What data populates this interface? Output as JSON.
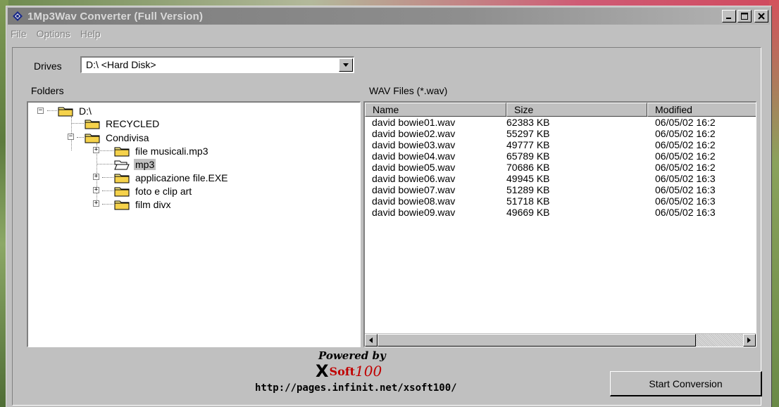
{
  "window": {
    "title": "1Mp3Wav Converter (Full Version)"
  },
  "menu": [
    {
      "label": "File"
    },
    {
      "label": "Options"
    },
    {
      "label": "Help"
    }
  ],
  "drives": {
    "label": "Drives",
    "selected": "D:\\ <Hard Disk>"
  },
  "folders": {
    "label": "Folders",
    "nodes": [
      {
        "label": "D:\\",
        "level": 0,
        "expanded": true
      },
      {
        "label": "RECYCLED",
        "level": 1
      },
      {
        "label": "Condivisa",
        "level": 1,
        "expanded": true
      },
      {
        "label": "file musicali.mp3",
        "level": 2,
        "collapsed": true
      },
      {
        "label": "mp3",
        "level": 2,
        "selected": true,
        "open": true
      },
      {
        "label": "applicazione file.EXE",
        "level": 2,
        "collapsed": true
      },
      {
        "label": "foto e clip art",
        "level": 2,
        "collapsed": true
      },
      {
        "label": "film divx",
        "level": 2,
        "collapsed": true
      }
    ]
  },
  "wav": {
    "label": "WAV Files (*.wav)",
    "columns": [
      "Name",
      "Size",
      "Modified"
    ],
    "rows": [
      [
        "david bowie01.wav",
        "62383 KB",
        "06/05/02 16:2"
      ],
      [
        "david bowie02.wav",
        "55297 KB",
        "06/05/02 16:2"
      ],
      [
        "david bowie03.wav",
        "49777 KB",
        "06/05/02 16:2"
      ],
      [
        "david bowie04.wav",
        "65789 KB",
        "06/05/02 16:2"
      ],
      [
        "david bowie05.wav",
        "70686 KB",
        "06/05/02 16:2"
      ],
      [
        "david bowie06.wav",
        "49945 KB",
        "06/05/02 16:3"
      ],
      [
        "david bowie07.wav",
        "51289 KB",
        "06/05/02 16:3"
      ],
      [
        "david bowie08.wav",
        "51718 KB",
        "06/05/02 16:3"
      ],
      [
        "david bowie09.wav",
        "49669 KB",
        "06/05/02 16:3"
      ]
    ]
  },
  "branding": {
    "powered": "Powered by",
    "logo_x": "X",
    "logo_soft": "Soft",
    "logo_num": "100",
    "url": "http://pages.infinit.net/xsoft100/"
  },
  "actions": {
    "start": "Start Conversion"
  },
  "colors": {
    "face": "#c0c0c0",
    "logo_red": "#c00000"
  }
}
